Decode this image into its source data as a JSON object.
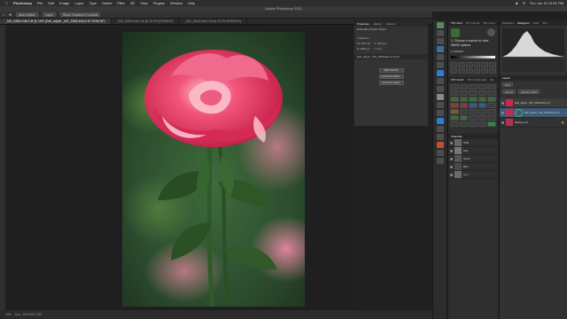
{
  "menubar": {
    "app": "Photoshop",
    "items": [
      "File",
      "Edit",
      "Image",
      "Layer",
      "Type",
      "Select",
      "Filter",
      "3D",
      "View",
      "Plugins",
      "Window",
      "Help"
    ],
    "clock": "Thu Jun 10  12:51 PM"
  },
  "window_title": "Adobe Photoshop 2021",
  "options": {
    "auto_select": "Auto-Select:",
    "layer": "Layer",
    "show_transform": "Show Transform Controls"
  },
  "tabs": [
    {
      "label": "_MG_5366-Edit-2.tif @ 16% (Edit_adjust _MG_5366-Edit-2.tif, RGB/16*)",
      "active": true
    },
    {
      "label": "_MG_5366-Edit-2.tif @ 33.3% (RGB/16*)",
      "active": false
    },
    {
      "label": "_MG_5516-Edit-2.tif @ 33.3% (RGB/16*)",
      "active": false
    }
  ],
  "status": {
    "zoom": "16%",
    "doc": "Doc: 103.9M/1.25G"
  },
  "properties": {
    "tabs": [
      "Properties",
      "History",
      "Actions"
    ],
    "kind": "Embedded Smart Object",
    "section": "Transform",
    "w_label": "W:",
    "w_value": "3071 px",
    "x_label": "X:",
    "x_value": "2072 px",
    "h_label": "H:",
    "h_value": "4601 px",
    "y_label": "Y:",
    "y_value": "0 px",
    "filename": "Edit_adjust _MG_5366-Edit-2.tif.psb",
    "buttons": [
      "Edit Contents",
      "Convert to Linked...",
      "Convert to Layers"
    ]
  },
  "mid_panel": {
    "title_tabs": [
      "TK7 Cont",
      "TK7 Lum M",
      "TK7 Lum I"
    ],
    "instruction": "1. Choose a source to view MASK options",
    "brushes_label": "2. MASKS",
    "lower_tabs": [
      "TK7 Comb",
      "TK7 Combo Met",
      "Sd"
    ]
  },
  "channels": {
    "title": "Channels",
    "items": [
      "RGB",
      "Red",
      "Green",
      "Blue",
      "Lum"
    ]
  },
  "right_panel": {
    "tabs": [
      "Navigator",
      "Histogram",
      "Color",
      "Info"
    ],
    "layers_title": "Layers",
    "kind": "Kind",
    "mode": "Normal",
    "opacity": "Opacity: 100%",
    "layers": [
      {
        "name": "Edit_adjust _MG_5366-Edit-2.tif"
      },
      {
        "name": "Edit_adjust _MG_5366-Edit-2.tif"
      },
      {
        "name": "Background"
      }
    ]
  },
  "colors": {
    "accent": "#2f7bd6",
    "rose": "#e8305e",
    "leaf": "#2b5a24"
  }
}
